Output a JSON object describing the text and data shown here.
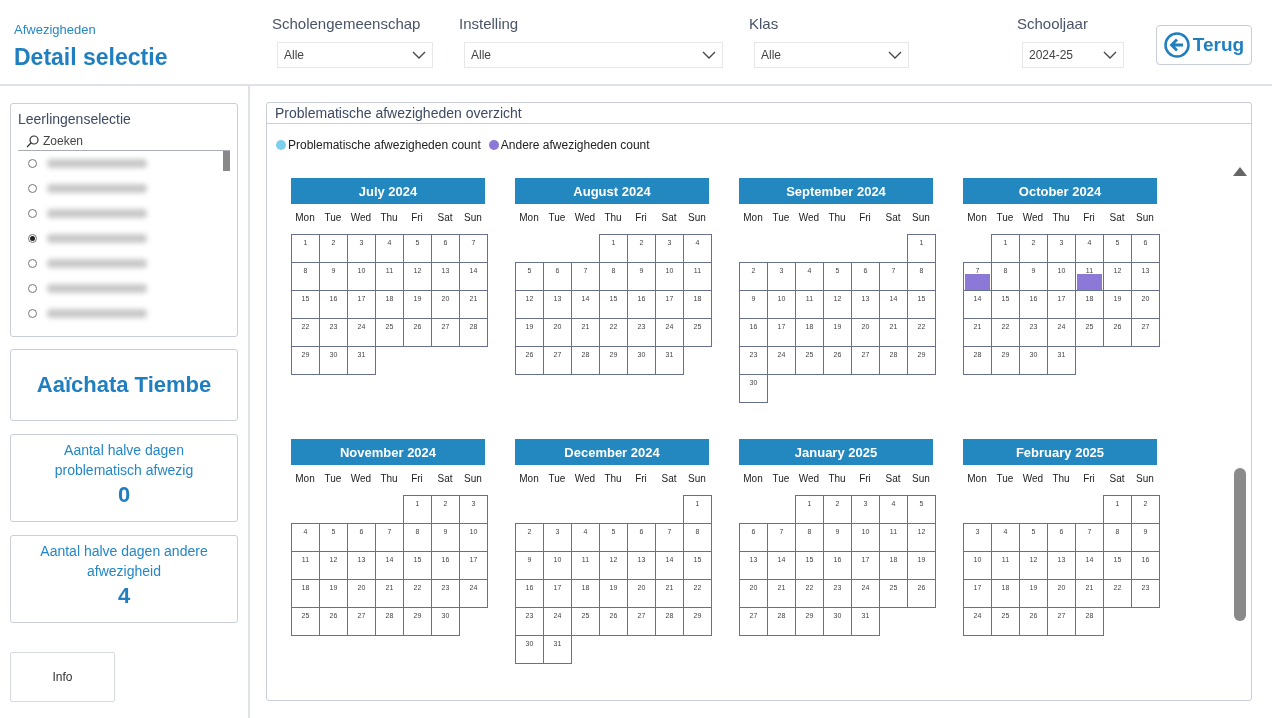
{
  "header": {
    "subtitle": "Afwezigheden",
    "title": "Detail selectie"
  },
  "filters": [
    {
      "label": "Scholengemeenschap",
      "value": "Alle"
    },
    {
      "label": "Instelling",
      "value": "Alle"
    },
    {
      "label": "Klas",
      "value": "Alle"
    },
    {
      "label": "Schooljaar",
      "value": "2024-25"
    }
  ],
  "back_button": {
    "label": "Terug"
  },
  "student_list": {
    "title": "Leerlingenselectie",
    "search": {
      "placeholder": "Zoeken"
    },
    "items": [
      {
        "selected": false
      },
      {
        "selected": false
      },
      {
        "selected": false
      },
      {
        "selected": true
      },
      {
        "selected": false
      },
      {
        "selected": false
      },
      {
        "selected": false
      }
    ]
  },
  "student_name": "Aaïchata Tiembe",
  "kpis": [
    {
      "label": "Aantal halve dagen problematisch afwezig",
      "value": "0"
    },
    {
      "label": "Aantal halve dagen andere afwezigheid",
      "value": "4"
    }
  ],
  "info_button": {
    "label": "Info"
  },
  "overview": {
    "title": "Problematische afwezigheden overzicht",
    "legend": [
      {
        "label": "Problematische afwezigheden count",
        "color": "#7dd0ec",
        "kind": "problematisch"
      },
      {
        "label": "Andere afwezigheden count",
        "color": "#8c78d6",
        "kind": "andere"
      }
    ],
    "months": [
      {
        "title": "July 2024",
        "weekdays": [
          "Mon",
          "Tue",
          "Wed",
          "Thu",
          "Fri",
          "Sat",
          "Sun"
        ],
        "days": [
          "1",
          "2",
          "3",
          "4",
          "5",
          "6",
          "7",
          "8",
          "9",
          "10",
          "11",
          "12",
          "13",
          "14",
          "15",
          "16",
          "17",
          "18",
          "19",
          "20",
          "21",
          "22",
          "23",
          "24",
          "25",
          "26",
          "27",
          "28",
          "29",
          "30",
          "31"
        ]
      },
      {
        "title": "August 2024",
        "weekdays": [
          "Mon",
          "Tue",
          "Wed",
          "Thu",
          "Fri",
          "Sat",
          "Sun"
        ],
        "days": [
          {
            "kind": "blank"
          },
          {
            "kind": "blank"
          },
          {
            "kind": "blank"
          },
          "1",
          "2",
          "3",
          "4",
          "5",
          "6",
          "7",
          "8",
          "9",
          "10",
          "11",
          "12",
          "13",
          "14",
          "15",
          "16",
          "17",
          "18",
          "19",
          "20",
          "21",
          "22",
          "23",
          "24",
          "25",
          "26",
          "27",
          "28",
          "29",
          "30",
          "31"
        ]
      },
      {
        "title": "September 2024",
        "weekdays": [
          "Mon",
          "Tue",
          "Wed",
          "Thu",
          "Fri",
          "Sat",
          "Sun"
        ],
        "days": [
          {
            "kind": "blank"
          },
          {
            "kind": "blank"
          },
          {
            "kind": "blank"
          },
          {
            "kind": "blank"
          },
          {
            "kind": "blank"
          },
          {
            "kind": "blank"
          },
          "1",
          "2",
          "3",
          "4",
          "5",
          "6",
          "7",
          "8",
          "9",
          "10",
          "11",
          "12",
          "13",
          "14",
          "15",
          "16",
          "17",
          "18",
          "19",
          "20",
          "21",
          "22",
          "23",
          "24",
          "25",
          "26",
          "27",
          "28",
          "29",
          "30"
        ]
      },
      {
        "title": "October 2024",
        "weekdays": [
          "Mon",
          "Tue",
          "Wed",
          "Thu",
          "Fri",
          "Sat",
          "Sun"
        ],
        "days": [
          {
            "kind": "blank"
          },
          "1",
          "2",
          "3",
          "4",
          "5",
          "6",
          {
            "label": "7",
            "kind": "andere"
          },
          "8",
          "9",
          "10",
          {
            "label": "11",
            "kind": "andere"
          },
          "12",
          "13",
          "14",
          "15",
          "16",
          "17",
          "18",
          "19",
          "20",
          "21",
          "22",
          "23",
          "24",
          "25",
          "26",
          "27",
          "28",
          "29",
          "30",
          "31"
        ]
      },
      {
        "title": "November 2024",
        "weekdays": [
          "Mon",
          "Tue",
          "Wed",
          "Thu",
          "Fri",
          "Sat",
          "Sun"
        ],
        "days": [
          {
            "kind": "blank"
          },
          {
            "kind": "blank"
          },
          {
            "kind": "blank"
          },
          {
            "kind": "blank"
          },
          "1",
          "2",
          "3",
          "4",
          "5",
          "6",
          "7",
          "8",
          "9",
          "10",
          "11",
          "12",
          "13",
          "14",
          "15",
          "16",
          "17",
          "18",
          "19",
          "20",
          "21",
          "22",
          "23",
          "24",
          "25",
          "26",
          "27",
          "28",
          "29",
          "30"
        ]
      },
      {
        "title": "December 2024",
        "weekdays": [
          "Mon",
          "Tue",
          "Wed",
          "Thu",
          "Fri",
          "Sat",
          "Sun"
        ],
        "days": [
          {
            "kind": "blank"
          },
          {
            "kind": "blank"
          },
          {
            "kind": "blank"
          },
          {
            "kind": "blank"
          },
          {
            "kind": "blank"
          },
          {
            "kind": "blank"
          },
          "1",
          "2",
          "3",
          "4",
          "5",
          "6",
          "7",
          "8",
          "9",
          "10",
          "11",
          "12",
          "13",
          "14",
          "15",
          "16",
          "17",
          "18",
          "19",
          "20",
          "21",
          "22",
          "23",
          "24",
          "25",
          "26",
          "27",
          "28",
          "29",
          "30",
          "31"
        ]
      },
      {
        "title": "January 2025",
        "weekdays": [
          "Mon",
          "Tue",
          "Wed",
          "Thu",
          "Fri",
          "Sat",
          "Sun"
        ],
        "days": [
          {
            "kind": "blank"
          },
          {
            "kind": "blank"
          },
          "1",
          "2",
          "3",
          "4",
          "5",
          "6",
          "7",
          "8",
          "9",
          "10",
          "11",
          "12",
          "13",
          "14",
          "15",
          "16",
          "17",
          "18",
          "19",
          "20",
          "21",
          "22",
          "23",
          "24",
          "25",
          "26",
          "27",
          "28",
          "29",
          "30",
          "31"
        ]
      },
      {
        "title": "February 2025",
        "weekdays": [
          "Mon",
          "Tue",
          "Wed",
          "Thu",
          "Fri",
          "Sat",
          "Sun"
        ],
        "days": [
          {
            "kind": "blank"
          },
          {
            "kind": "blank"
          },
          {
            "kind": "blank"
          },
          {
            "kind": "blank"
          },
          {
            "kind": "blank"
          },
          "1",
          "2",
          "3",
          "4",
          "5",
          "6",
          "7",
          "8",
          "9",
          "10",
          "11",
          "12",
          "13",
          "14",
          "15",
          "16",
          "17",
          "18",
          "19",
          "20",
          "21",
          "22",
          "23",
          "24",
          "25",
          "26",
          "27",
          "28"
        ]
      }
    ]
  }
}
